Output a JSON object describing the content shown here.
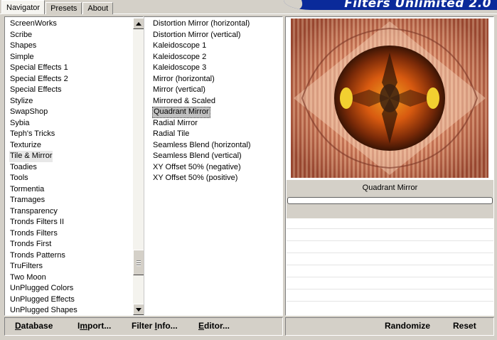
{
  "tabs": [
    "Navigator",
    "Presets",
    "About"
  ],
  "logo": {
    "text": "Filters Unlimited 2.0",
    "color": "#0a2a9a"
  },
  "categories": {
    "items": [
      "ScreenWorks",
      "Scribe",
      "Shapes",
      "Simple",
      "Special Effects 1",
      "Special Effects 2",
      "Special Effects",
      "Stylize",
      "SwapShop",
      "Sybia",
      "Teph's Tricks",
      "Texturize",
      "Tile & Mirror",
      "Toadies",
      "Tools",
      "Tormentia",
      "Tramages",
      "Transparency",
      "Tronds Filters II",
      "Tronds Filters",
      "Tronds First",
      "Tronds Patterns",
      "TruFilters",
      "Two Moon",
      "UnPlugged Colors",
      "UnPlugged Effects",
      "UnPlugged Shapes"
    ],
    "selected": "Tile & Mirror"
  },
  "filters": {
    "items": [
      "Distortion Mirror (horizontal)",
      "Distortion Mirror (vertical)",
      "Kaleidoscope 1",
      "Kaleidoscope 2",
      "Kaleidoscope 3",
      "Mirror (horizontal)",
      "Mirror (vertical)",
      "Mirrored & Scaled",
      "Quadrant Mirror",
      "Radial Mirror",
      "Radial Tile",
      "Seamless Blend (horizontal)",
      "Seamless Blend (vertical)",
      "XY Offset 50% (negative)",
      "XY Offset 50% (positive)"
    ],
    "selected": "Quadrant Mirror"
  },
  "preview": {
    "filter_name": "Quadrant Mirror",
    "progress": 0
  },
  "buttons": {
    "database": {
      "u": "D",
      "rest": "atabase"
    },
    "import": {
      "pre": "I",
      "u": "m",
      "rest": "port..."
    },
    "filter_info": {
      "pre": "Filter ",
      "u": "I",
      "rest": "nfo..."
    },
    "editor": {
      "u": "E",
      "rest": "ditor..."
    },
    "randomize": "Randomize",
    "reset": "Reset"
  },
  "colors": {
    "accent": "#0a2a9a",
    "face": "#d4d0c8",
    "selection": "#c0c0c0"
  }
}
